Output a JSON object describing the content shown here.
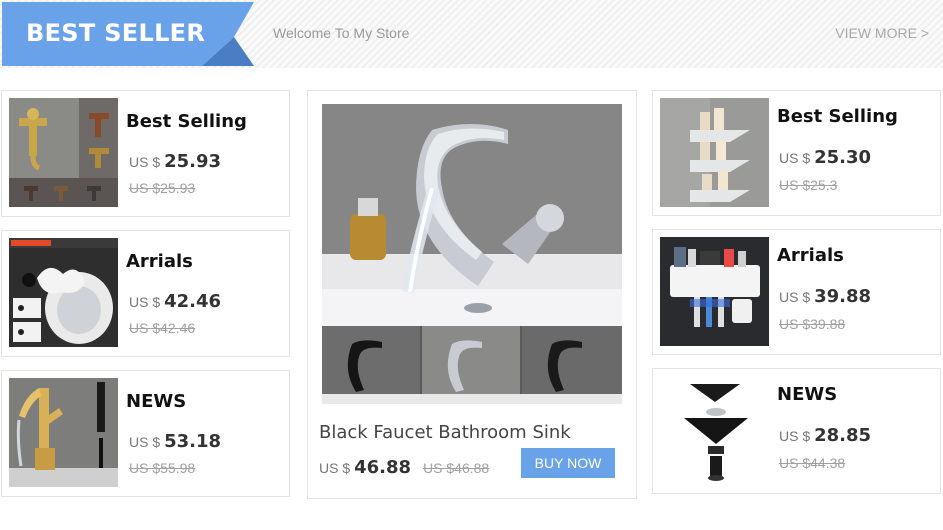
{
  "header": {
    "badge_label": "BEST SELLER",
    "welcome": "Welcome To My Store",
    "view_more": "VIEW MORE >"
  },
  "colors": {
    "accent": "#6aa2ea",
    "badge_dark": "#4a7ec4"
  },
  "left_products": [
    {
      "title": "Best Selling",
      "currency": "US $",
      "price": "25.93",
      "old_price": "US $25.93",
      "image": "bronze-wall-tap-collage"
    },
    {
      "title": "Arrials",
      "currency": "US $",
      "price": "42.46",
      "old_price": "US $42.46",
      "image": "cloud-toilet-seat"
    },
    {
      "title": "NEWS",
      "currency": "US $",
      "price": "53.18",
      "old_price": "US $55.98",
      "image": "gold-faucet"
    }
  ],
  "featured": {
    "title": "Black Faucet Bathroom Sink",
    "currency": "US $",
    "price": "46.88",
    "old_price": "US $46.88",
    "buy_label": "BUY NOW",
    "image": "chrome-waterfall-faucet"
  },
  "right_products": [
    {
      "title": "Best Selling",
      "currency": "US $",
      "price": "25.30",
      "old_price": "US $25.3",
      "image": "corner-glass-shelf"
    },
    {
      "title": "Arrials",
      "currency": "US $",
      "price": "39.88",
      "old_price": "US $39.88",
      "image": "toothbrush-holder"
    },
    {
      "title": "NEWS",
      "currency": "US $",
      "price": "28.85",
      "old_price": "US $44.38",
      "image": "triangle-floor-drain"
    }
  ]
}
